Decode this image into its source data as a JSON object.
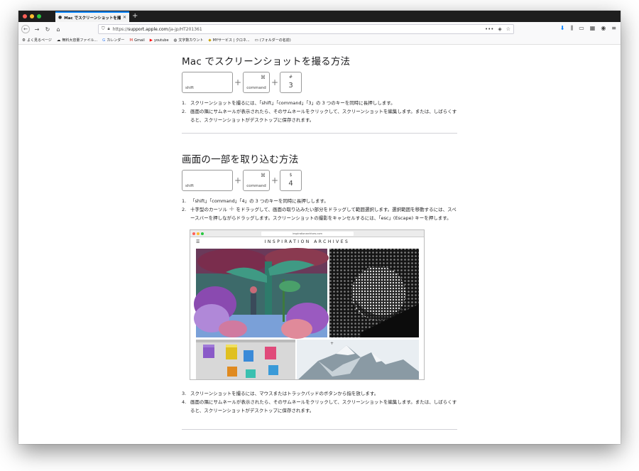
{
  "browser": {
    "tab_title": "Mac でスクリーンショットを撮る",
    "tab_favicon": "apple-icon",
    "url_prefix": "https://",
    "url_host": "support.apple.com",
    "url_path": "/ja-jp/HT201361",
    "bookmarks": [
      {
        "icon": "gear-icon",
        "label": "よく見るページ"
      },
      {
        "icon": "cloud-icon",
        "label": "無料大容量ファイル..."
      },
      {
        "icon": "google-icon",
        "label": "カレンダー"
      },
      {
        "icon": "gmail-icon",
        "label": "Gmail"
      },
      {
        "icon": "youtube-icon",
        "label": "youtube"
      },
      {
        "icon": "counter-icon",
        "label": "文字数カウント"
      },
      {
        "icon": "myservice-icon",
        "label": "MYサービス | クロネ..."
      },
      {
        "icon": "folder-icon",
        "label": "(フォルダーの名前)"
      }
    ]
  },
  "section1": {
    "title": "Mac でスクリーンショットを撮る方法",
    "key_shift": "shift",
    "key_command_symbol": "⌘",
    "key_command": "command",
    "key3_top": "#",
    "key3_main": "3",
    "steps": [
      {
        "num": "1.",
        "text": "スクリーンショットを撮るには、「shift」「command」「3」の 3 つのキーを同時に長押しします。"
      },
      {
        "num": "2.",
        "text": "画面の隅にサムネールが表示されたら、そのサムネールをクリックして、スクリーンショットを編集します。または、しばらくすると、スクリーンショットがデスクトップに保存されます。"
      }
    ]
  },
  "section2": {
    "title": "画面の一部を取り込む方法",
    "key_shift": "shift",
    "key_command_symbol": "⌘",
    "key_command": "command",
    "key4_top": "$",
    "key4_main": "4",
    "steps": [
      {
        "num": "1.",
        "text": "「shift」「command」「4」の 3 つのキーを同時に長押しします。"
      },
      {
        "num": "2.",
        "text_before": "十字型のカーソル",
        "text_after": "をドラッグして、画面の取り込みたい部分をドラッグして範囲選択します。選択範囲を移動するには、スペースバーを押しながらドラッグします。スクリーンショットの撮影をキャンセルするには、「esc」(Escape) キーを押します。"
      },
      {
        "num": "3.",
        "text": "スクリーンショットを撮るには、マウスまたはトラックパッドのボタンから指を放します。"
      },
      {
        "num": "4.",
        "text": "画面の隅にサムネールが表示されたら、そのサムネールをクリックして、スクリーンショットを編集します。または、しばらくすると、スクリーンショットがデスクトップに保存されます。"
      }
    ]
  },
  "screenshot": {
    "url": "inspirationarchives.com",
    "site_title": "INSPIRATION ARCHIVES"
  }
}
